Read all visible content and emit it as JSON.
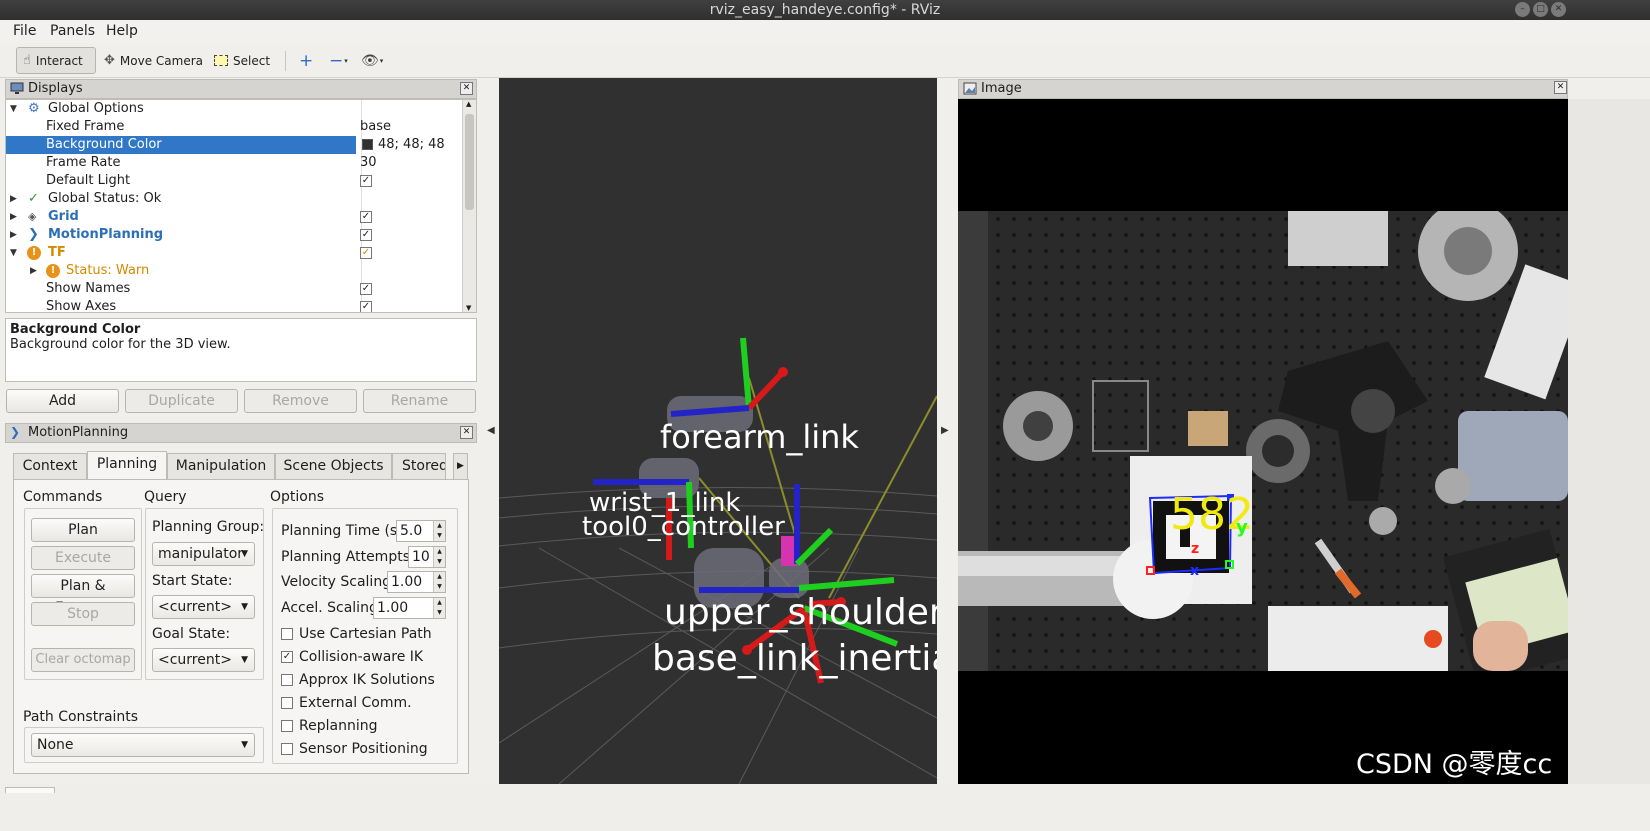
{
  "window": {
    "title": "rviz_easy_handeye.config* - RViz"
  },
  "menu": {
    "file": "File",
    "panels": "Panels",
    "help": "Help"
  },
  "toolbar": {
    "interact": "Interact",
    "move_camera": "Move Camera",
    "select": "Select"
  },
  "displays": {
    "title": "Displays",
    "rows": [
      {
        "label": "Global Options",
        "value": ""
      },
      {
        "label": "Fixed Frame",
        "value": "base"
      },
      {
        "label": "Background Color",
        "value": "48; 48; 48"
      },
      {
        "label": "Frame Rate",
        "value": "30"
      },
      {
        "label": "Default Light",
        "value": ""
      },
      {
        "label": "Global Status: Ok",
        "value": ""
      },
      {
        "label": "Grid",
        "value": ""
      },
      {
        "label": "MotionPlanning",
        "value": ""
      },
      {
        "label": "TF",
        "value": ""
      },
      {
        "label": "Status: Warn",
        "value": ""
      },
      {
        "label": "Show Names",
        "value": ""
      },
      {
        "label": "Show Axes",
        "value": ""
      }
    ],
    "description": {
      "title": "Background Color",
      "text": "Background color for the 3D view."
    },
    "buttons": {
      "add": "Add",
      "duplicate": "Duplicate",
      "remove": "Remove",
      "rename": "Rename"
    }
  },
  "motion_planning": {
    "title": "MotionPlanning",
    "tabs": [
      "Context",
      "Planning",
      "Manipulation",
      "Scene Objects",
      "Stored"
    ],
    "commands": {
      "heading": "Commands",
      "plan": "Plan",
      "execute": "Execute",
      "plan_execute": "Plan & Execute",
      "stop": "Stop",
      "clear_octomap": "Clear octomap"
    },
    "query": {
      "heading": "Query",
      "planning_group_label": "Planning Group:",
      "planning_group": "manipulator",
      "start_state_label": "Start State:",
      "start_state": "<current>",
      "goal_state_label": "Goal State:",
      "goal_state": "<current>"
    },
    "options": {
      "heading": "Options",
      "planning_time_label": "Planning Time (s):",
      "planning_time": "5.0",
      "planning_attempts_label": "Planning Attempts:",
      "planning_attempts": "10",
      "velocity_scaling_label": "Velocity Scaling:",
      "velocity_scaling": "1.00",
      "accel_scaling_label": "Accel. Scaling:",
      "accel_scaling": "1.00",
      "checks": [
        {
          "label": "Use Cartesian Path",
          "checked": false
        },
        {
          "label": "Collision-aware IK",
          "checked": true
        },
        {
          "label": "Approx IK Solutions",
          "checked": false
        },
        {
          "label": "External Comm.",
          "checked": false
        },
        {
          "label": "Replanning",
          "checked": false
        },
        {
          "label": "Sensor Positioning",
          "checked": false
        }
      ]
    },
    "path_constraints": {
      "heading": "Path Constraints",
      "value": "None"
    }
  },
  "view3d": {
    "background": "#303030",
    "labels": {
      "forearm": "forearm_link",
      "wrist": "wrist_1_link",
      "tool": "tool0_controller",
      "shoulder": "upper_shoulder_link",
      "base": "base_link_inertia"
    }
  },
  "image_panel": {
    "title": "Image",
    "marker_id": "582",
    "axis_x": "x",
    "axis_y": "y",
    "axis_z": "z"
  },
  "watermark": "CSDN @零度cc"
}
